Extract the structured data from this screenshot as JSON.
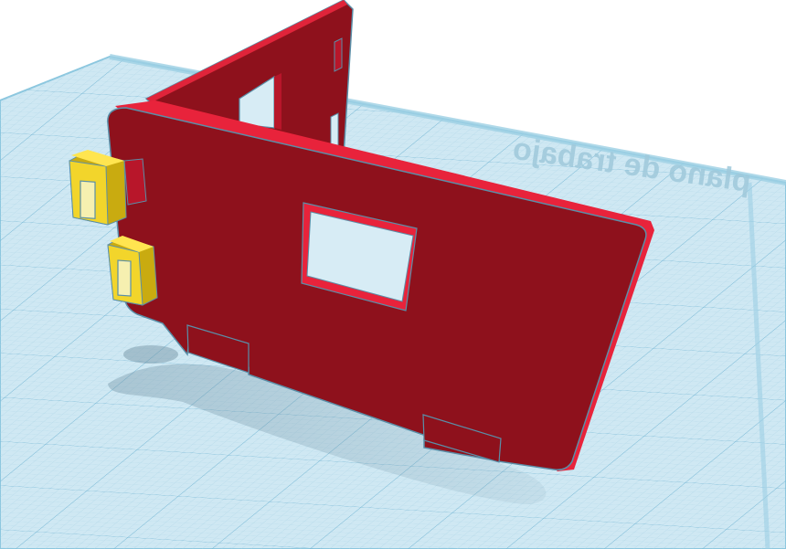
{
  "workplane": {
    "label": "plano de trabajo",
    "colors": {
      "background": "#ffffff",
      "grid_fill": "#cfe8f3",
      "grid_line_minor": "#a9d3e6",
      "grid_line_major": "#6fb3d2",
      "edge": "#8cc7df"
    }
  },
  "objects": [
    {
      "name": "front-panel",
      "shape": "box-with-square-hole",
      "color": "#8e111c"
    },
    {
      "name": "side-panel",
      "shape": "box-with-window",
      "color": "#8e111c"
    },
    {
      "name": "upper-clip",
      "shape": "slotted-block",
      "color": "#f2d52b"
    },
    {
      "name": "lower-clip",
      "shape": "slotted-block",
      "color": "#f2d52b"
    }
  ]
}
